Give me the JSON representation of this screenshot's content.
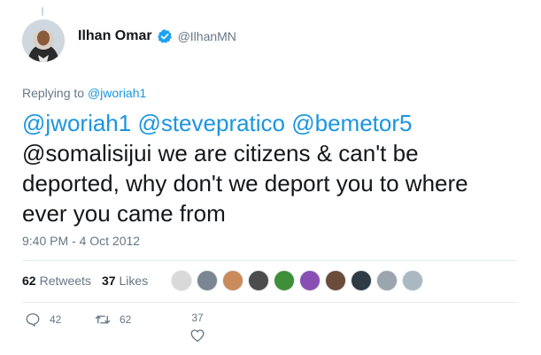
{
  "author": {
    "name": "Ilhan Omar",
    "handle": "@IlhanMN",
    "verified": true
  },
  "replying": {
    "prefix": "Replying to ",
    "mention": "@jworiah1"
  },
  "tweet": {
    "mentions_line": "@jworiah1 @stevepratico @bemetor5",
    "mention_tail": "@somalisijui",
    "text_rest": " we are citizens & can't be deported, why don't we deport you to where ever you came from"
  },
  "timestamp": "9:40 PM - 4 Oct 2012",
  "stats": {
    "retweets_count": "62",
    "retweets_label": "Retweets",
    "likes_count": "37",
    "likes_label": "Likes"
  },
  "likers": [
    {
      "icon": "avatar-1",
      "color": "#d9d9d9"
    },
    {
      "icon": "avatar-2",
      "color": "#7a8792"
    },
    {
      "icon": "avatar-3",
      "color": "#c98b5c"
    },
    {
      "icon": "avatar-4",
      "color": "#4c4c4c"
    },
    {
      "icon": "avatar-5",
      "color": "#3f8f3a"
    },
    {
      "icon": "avatar-6",
      "color": "#8a4fb3"
    },
    {
      "icon": "avatar-7",
      "color": "#6b4b3a"
    },
    {
      "icon": "avatar-8",
      "color": "#2f3b45"
    },
    {
      "icon": "avatar-9",
      "color": "#9aa5ad"
    },
    {
      "icon": "avatar-10",
      "color": "#aab8c2"
    }
  ],
  "actions": {
    "replies": "42",
    "retweets": "62",
    "likes": "37"
  },
  "colors": {
    "link": "#1b95e0",
    "secondary": "#657786",
    "verified": "#1da1f2"
  }
}
